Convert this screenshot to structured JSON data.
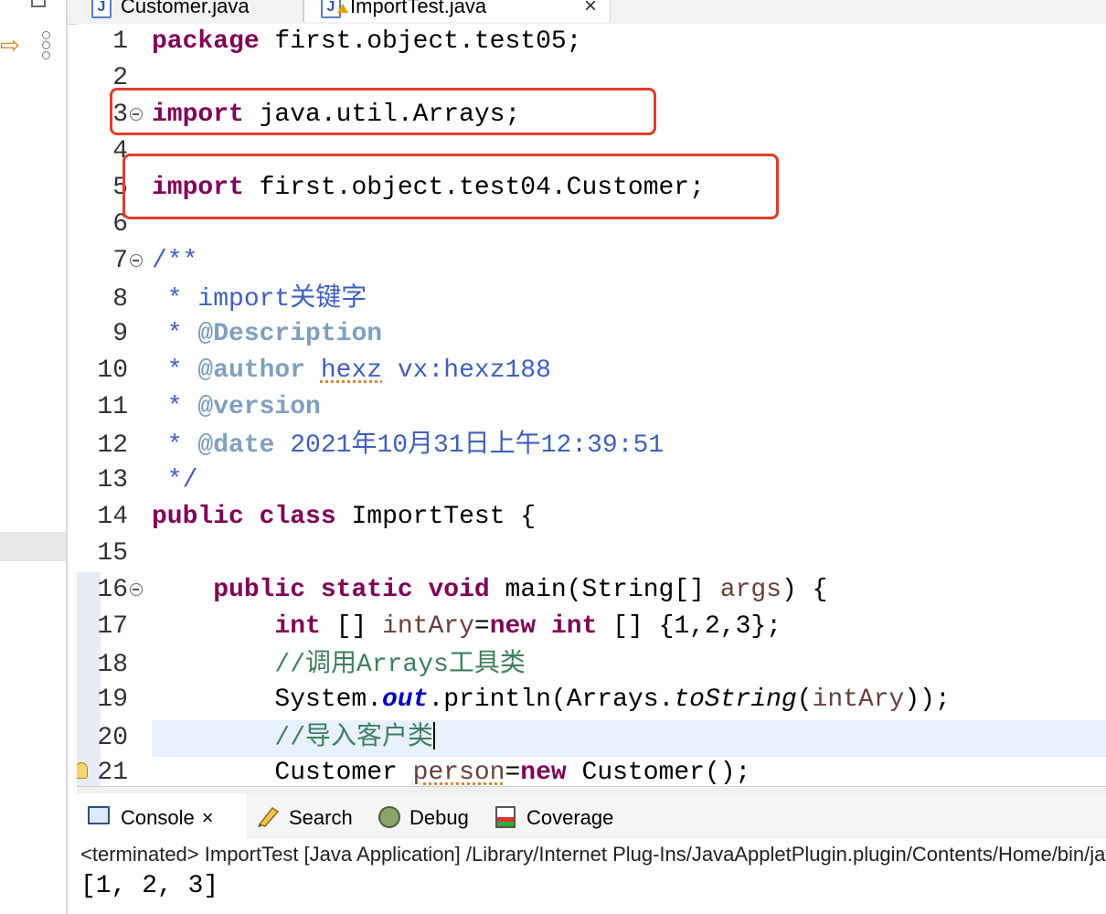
{
  "tabs": [
    {
      "label": "Customer.java",
      "active": false
    },
    {
      "label": "ImportTest.java",
      "active": true,
      "close": "×"
    }
  ],
  "editor": {
    "lines": [
      {
        "n": "1"
      },
      {
        "n": "2"
      },
      {
        "n": "3"
      },
      {
        "n": "4"
      },
      {
        "n": "5"
      },
      {
        "n": "6"
      },
      {
        "n": "7"
      },
      {
        "n": "8"
      },
      {
        "n": "9"
      },
      {
        "n": "10"
      },
      {
        "n": "11"
      },
      {
        "n": "12"
      },
      {
        "n": "13"
      },
      {
        "n": "14"
      },
      {
        "n": "15"
      },
      {
        "n": "16"
      },
      {
        "n": "17"
      },
      {
        "n": "18"
      },
      {
        "n": "19"
      },
      {
        "n": "20"
      },
      {
        "n": "21"
      }
    ],
    "tokens": {
      "package_kw": "package",
      "package_name": " first.object.test05;",
      "import_kw": "import",
      "import1": " java.util.Arrays;",
      "import2": " first.object.test04.Customer;",
      "doc_open": "/**",
      "doc_star": " * ",
      "doc_title": "import关键字",
      "tag_description": "@Description",
      "tag_author": "@author",
      "author_name": "hexz",
      "author_rest": " vx:hexz188",
      "tag_version": "@version",
      "tag_date": "@date",
      "date_value": " 2021年10月31日上午12:39:51",
      "doc_close": " */",
      "public_kw": "public",
      "class_kw": "class",
      "class_name": " ImportTest {",
      "static_kw": "static",
      "void_kw": "void",
      "main_sig": " main(String[] ",
      "args": "args",
      "main_end": ") {",
      "int_kw": "int",
      "arr_brackets": " [] ",
      "intAry": "intAry",
      "eq": "=",
      "new_kw": "new",
      "arr_init": " [] {1,2,3};",
      "comment1": "//调用Arrays工具类",
      "sys": "System.",
      "out": "out",
      "println": ".println(Arrays.",
      "toString": "toString",
      "paren_open": "(",
      "paren_close": "));",
      "comment2": "//导入客户类",
      "customer": "Customer ",
      "person": "person",
      "ctor": " Customer();"
    }
  },
  "console": {
    "tabs": [
      {
        "label": "Console",
        "icon": "console-icon"
      },
      {
        "label": "Search",
        "icon": "search-icon"
      },
      {
        "label": "Debug",
        "icon": "debug-icon"
      },
      {
        "label": "Coverage",
        "icon": "coverage-icon"
      }
    ],
    "close": "×",
    "status": "<terminated> ImportTest [Java Application] /Library/Internet Plug-Ins/JavaAppletPlugin.plugin/Contents/Home/bin/java",
    "output": "[1, 2, 3]"
  },
  "colors": {
    "highlight_box": "#e03d2a",
    "keyword": "#7f0055",
    "comment": "#3f7f5f",
    "javadoc": "#3f5fbf"
  }
}
